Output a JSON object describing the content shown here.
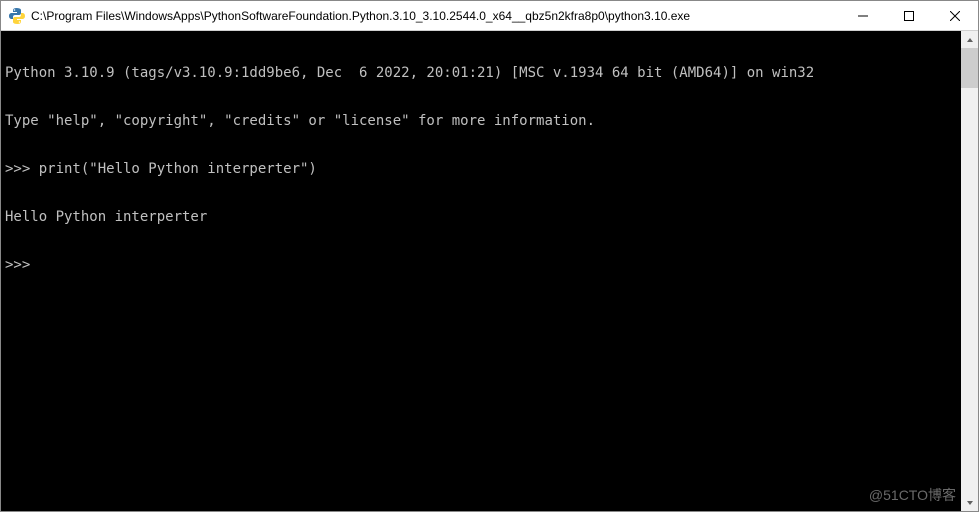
{
  "window": {
    "title": "C:\\Program Files\\WindowsApps\\PythonSoftwareFoundation.Python.3.10_3.10.2544.0_x64__qbz5n2kfra8p0\\python3.10.exe"
  },
  "console": {
    "lines": [
      "Python 3.10.9 (tags/v3.10.9:1dd9be6, Dec  6 2022, 20:01:21) [MSC v.1934 64 bit (AMD64)] on win32",
      "Type \"help\", \"copyright\", \"credits\" or \"license\" for more information.",
      ">>> print(\"Hello Python interperter\")",
      "Hello Python interperter",
      ">>> "
    ]
  },
  "watermark": "@51CTO博客"
}
